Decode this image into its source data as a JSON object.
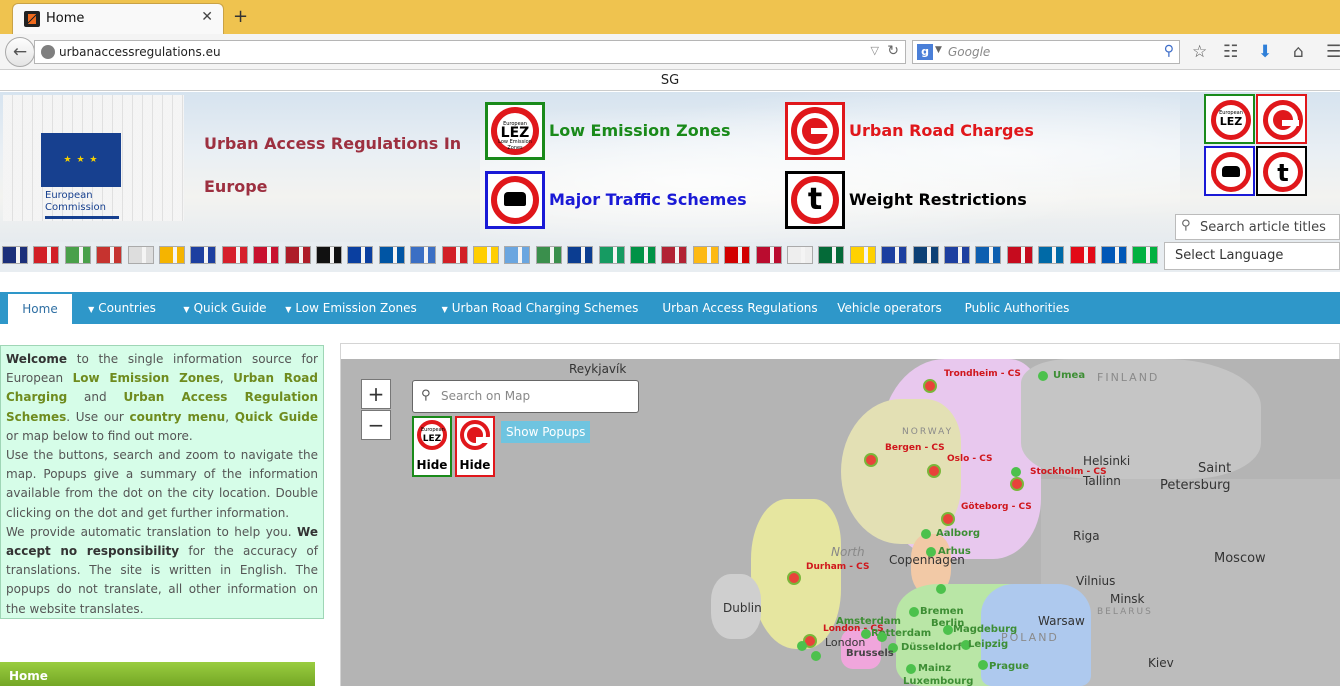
{
  "browser": {
    "tab_title": "Home",
    "url": "urbanaccessregulations.eu",
    "search_placeholder": "Google",
    "notice": "SG"
  },
  "header": {
    "ec_logo_lines": [
      "European",
      "Commission"
    ],
    "title_line1": "Urban Access Regulations In",
    "title_line2": "Europe",
    "badges": [
      {
        "label": "Low Emission Zones",
        "color": "#1a8a1a",
        "icon": "lez-icon"
      },
      {
        "label": "Urban Road Charges",
        "color": "#e0171b",
        "icon": "road-charge-icon"
      },
      {
        "label": "Major Traffic Schemes",
        "color": "#1a1ad6",
        "icon": "traffic-scheme-icon"
      },
      {
        "label": "Weight Restrictions",
        "color": "#000000",
        "icon": "weight-restriction-icon"
      }
    ],
    "lez_sign": {
      "main": "LEZ",
      "top": "European",
      "bottom": "Low Emission Zones"
    },
    "weight_sign": "t",
    "article_search_placeholder": "Search article titles"
  },
  "language": {
    "selected": "Select Language",
    "flags": [
      "#1b2f7a",
      "#d21f26",
      "#49a04a",
      "#c6332f",
      "#ddd",
      "#f5b400",
      "#1d3fa0",
      "#d61f2b",
      "#c8102e",
      "#ae1c28",
      "#111",
      "#0a3fa0",
      "#0055a4",
      "#3b6fc4",
      "#d21f26",
      "#ffce00",
      "#6aa6e0",
      "#3a8f4c",
      "#0b3d91",
      "#169b62",
      "#009246",
      "#b22234",
      "#fdb913",
      "#d20000",
      "#ba0c2f",
      "#eee",
      "#046a38",
      "#ffd100",
      "#1c3fa0",
      "#0c4076",
      "#1d3fa0",
      "#0e5fb0",
      "#c60b1e",
      "#006aa7",
      "#e30a17",
      "#0057b7",
      "#00b140"
    ]
  },
  "nav": {
    "items": [
      {
        "label": "Home",
        "active": true,
        "dropdown": false
      },
      {
        "label": "Countries",
        "active": false,
        "dropdown": true
      },
      {
        "label": "Quick Guide",
        "active": false,
        "dropdown": true
      },
      {
        "label": "Low Emission Zones",
        "active": false,
        "dropdown": true
      },
      {
        "label": "Urban Road Charging Schemes",
        "active": false,
        "dropdown": true
      },
      {
        "label": "Urban Access Regulations",
        "active": false,
        "dropdown": false
      },
      {
        "label": "Vehicle operators",
        "active": false,
        "dropdown": false
      },
      {
        "label": "Public Authorities",
        "active": false,
        "dropdown": false
      }
    ]
  },
  "welcome": {
    "p1": [
      "Welcome",
      " to the single information source for European ",
      "Low Emission Zones",
      ", ",
      "Urban Road Charging",
      " and ",
      "Urban Access Regulation Schemes",
      ". Use our ",
      "country menu",
      ", ",
      "Quick Guide",
      " or map below to find out more."
    ],
    "p2": "Use the buttons, search and zoom to navigate the map. Popups give a summary of the information available from the dot on the city location. Double clicking on the dot and get further information.",
    "p3": [
      "We provide automatic translation to help you. ",
      "We accept no responsibility",
      " for the accuracy of translations. The site is written in English. The popups do not translate, all other information on the website translates."
    ]
  },
  "sidebar": {
    "home_label": "Home"
  },
  "map": {
    "zoom_in": "+",
    "zoom_out": "−",
    "search_placeholder": "Search on Map",
    "hide_label": "Hide",
    "show_popups_label": "Show Popups",
    "city_labels": [
      "Reykjavík",
      "Helsinki",
      "Saint",
      "Petersburg",
      "Tallinn",
      "Riga",
      "Moscow",
      "Vilnius",
      "Minsk",
      "Warsaw",
      "Kiev",
      "Dublin",
      "North",
      "Copenhagen"
    ],
    "region_labels": [
      "FINLAND",
      "NORWAY",
      "BELARUS",
      "POLAND"
    ],
    "red_labels": [
      "Trondheim - CS",
      "Bergen - CS",
      "Oslo - CS",
      "Stockholm - CS",
      "Göteborg - CS",
      "Durham - CS",
      "London - CS"
    ],
    "green_labels": [
      "Umea",
      "Aalborg",
      "Arhus",
      "Bremen",
      "Berlin",
      "Magdeburg",
      "Rotterdam",
      "Düsseldorf",
      "Leipzig",
      "Mainz",
      "Prague",
      "Amsterdam",
      "Brussels",
      "Luxembourg",
      "London",
      "Oslo",
      "Stockholm"
    ]
  }
}
